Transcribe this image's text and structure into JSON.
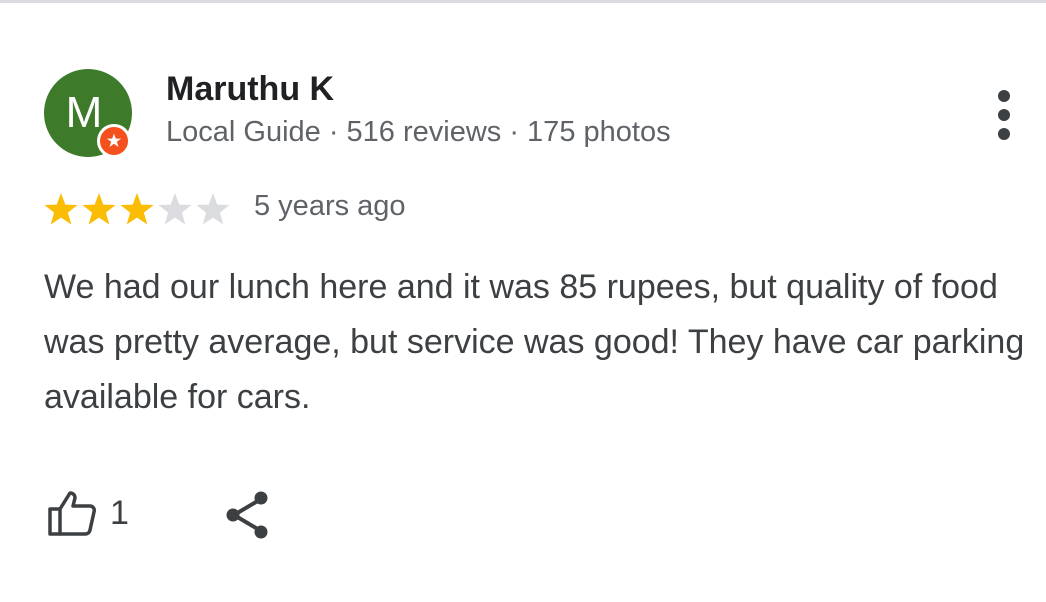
{
  "review": {
    "author": {
      "avatar_letter": "M",
      "avatar_color": "#3d7a2a",
      "badge_color": "#f4511e",
      "name": "Maruthu K",
      "meta": "Local Guide · 516 reviews · 175 photos"
    },
    "rating": {
      "stars_filled": 3,
      "stars_total": 5,
      "filled_color": "#fbbc04",
      "empty_color": "#dadce0"
    },
    "age": "5 years ago",
    "text": "We had our lunch here and it was 85 rupees, but quality of food was pretty average, but service was good! They have car parking available for cars.",
    "actions": {
      "like_icon": "thumb-up-icon",
      "like_count": "1",
      "share_icon": "share-icon",
      "more_icon": "more-vert-icon"
    }
  }
}
